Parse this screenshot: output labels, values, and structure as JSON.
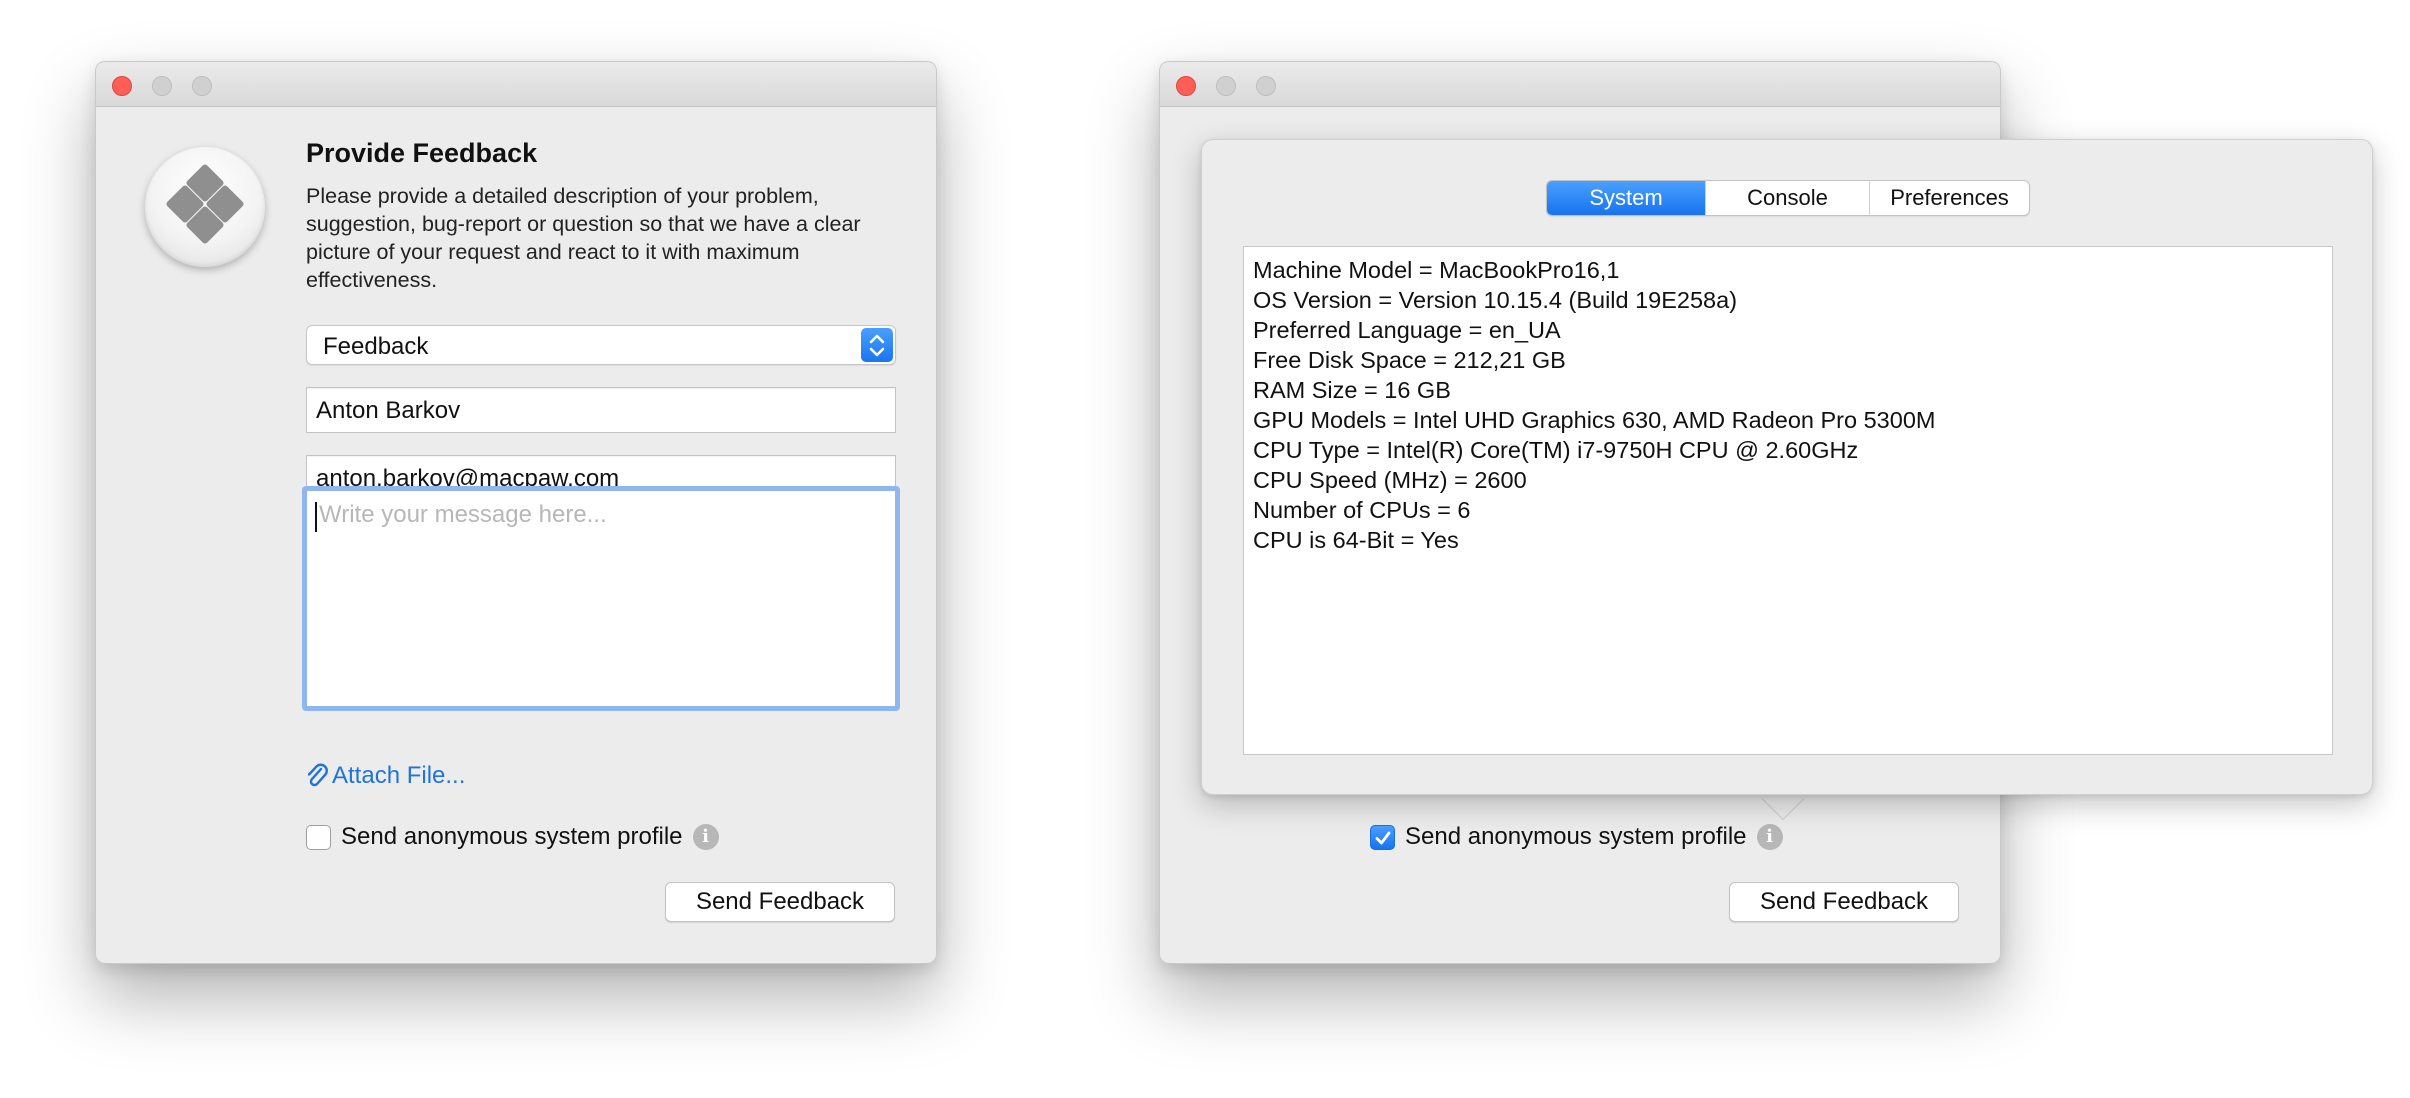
{
  "left_window": {
    "title": "Provide Feedback",
    "description": "Please provide a detailed description of your problem, suggestion, bug-report or question so that we have a clear picture of your request and react to it with maximum effectiveness.",
    "type_select": {
      "value": "Feedback"
    },
    "name_field": {
      "value": "Anton Barkov"
    },
    "email_field": {
      "value": "anton.barkov@macpaw.com"
    },
    "message_field": {
      "value": "",
      "placeholder": "Write your message here..."
    },
    "attach_label": "Attach File...",
    "profile_checkbox": {
      "label": "Send anonymous system profile",
      "checked": false
    },
    "send_button": "Send Feedback"
  },
  "right_window": {
    "tabs": [
      {
        "label": "System",
        "active": true
      },
      {
        "label": "Console",
        "active": false
      },
      {
        "label": "Preferences",
        "active": false
      }
    ],
    "system_info": [
      "Machine Model = MacBookPro16,1",
      "OS Version = Version 10.15.4 (Build 19E258a)",
      "Preferred Language = en_UA",
      "Free Disk Space = 212,21 GB",
      "RAM Size = 16 GB",
      "GPU Models = Intel UHD Graphics 630, AMD Radeon Pro 5300M",
      "CPU Type = Intel(R) Core(TM) i7-9750H CPU @ 2.60GHz",
      "CPU Speed (MHz) = 2600",
      "Number of CPUs = 6",
      "CPU is 64-Bit = Yes"
    ],
    "profile_checkbox": {
      "label": "Send anonymous system profile",
      "checked": true
    },
    "send_button": "Send Feedback"
  },
  "info_icon_glyph": "i",
  "colors": {
    "accent": "#1a75f0",
    "link": "#1e74d8",
    "close_light": "#fd5f57",
    "window_bg": "#ececec",
    "focus_ring": "#8fb6f0"
  },
  "icons": [
    "app-logo-icon",
    "chevron-updown-icon",
    "paperclip-icon",
    "info-icon",
    "checkmark-icon"
  ]
}
